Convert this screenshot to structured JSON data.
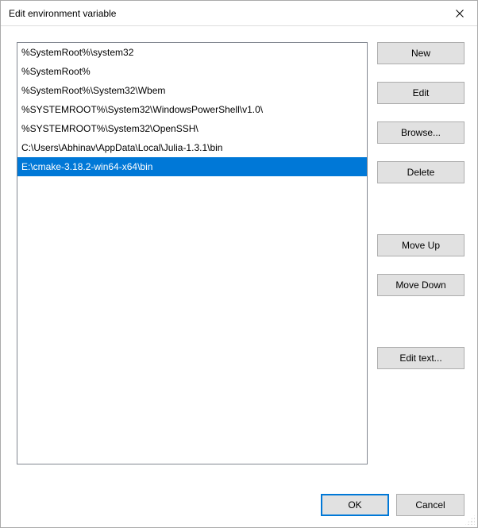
{
  "window": {
    "title": "Edit environment variable"
  },
  "paths": [
    "%SystemRoot%\\system32",
    "%SystemRoot%",
    "%SystemRoot%\\System32\\Wbem",
    "%SYSTEMROOT%\\System32\\WindowsPowerShell\\v1.0\\",
    "%SYSTEMROOT%\\System32\\OpenSSH\\",
    "C:\\Users\\Abhinav\\AppData\\Local\\Julia-1.3.1\\bin",
    "E:\\cmake-3.18.2-win64-x64\\bin"
  ],
  "selectedIndex": 6,
  "buttons": {
    "new": "New",
    "edit": "Edit",
    "browse": "Browse...",
    "delete": "Delete",
    "moveUp": "Move Up",
    "moveDown": "Move Down",
    "editText": "Edit text...",
    "ok": "OK",
    "cancel": "Cancel"
  }
}
